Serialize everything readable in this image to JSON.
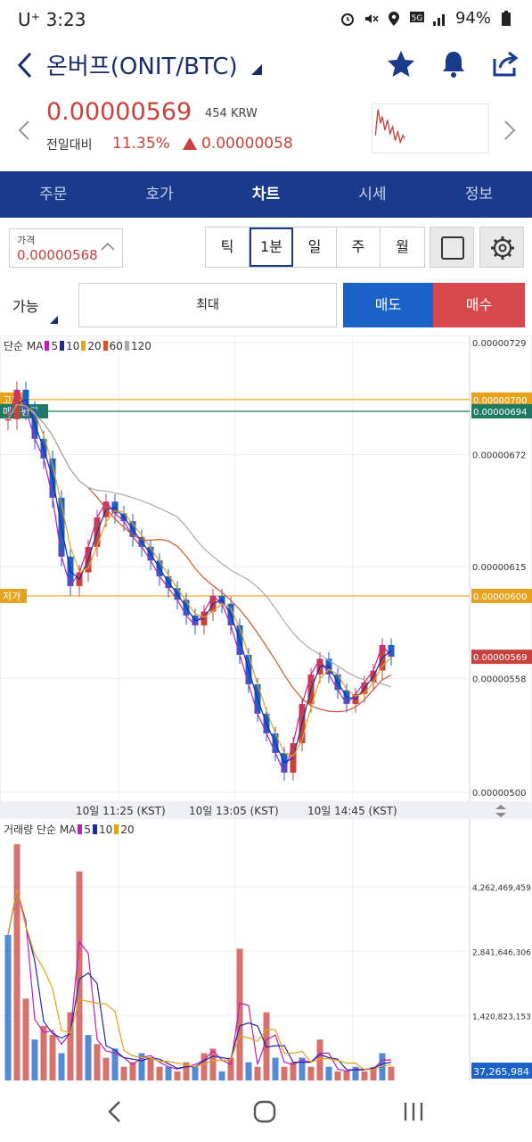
{
  "status_bar": {
    "carrier": "U⁺",
    "time": "3:23",
    "battery": "94%"
  },
  "header": {
    "title": "온버프(ONIT/BTC)"
  },
  "summary": {
    "price": "0.00000569",
    "krw": "454 KRW",
    "change_label": "전일대비",
    "change_pct": "11.35%",
    "change_value": "0.00000058"
  },
  "tabs": [
    {
      "label": "주문"
    },
    {
      "label": "호가"
    },
    {
      "label": "차트",
      "active": true
    },
    {
      "label": "시세"
    },
    {
      "label": "정보"
    }
  ],
  "controls": {
    "price_label": "가격",
    "price_value": "0.00000568",
    "periods": [
      {
        "label": "틱"
      },
      {
        "label": "1분",
        "active": true
      },
      {
        "label": "일"
      },
      {
        "label": "주"
      },
      {
        "label": "월"
      }
    ],
    "available_label": "가능",
    "max_label": "최대",
    "sell_label": "매도",
    "buy_label": "매수"
  },
  "colors": {
    "brand": "#1a3a8c",
    "up": "#c8423d",
    "down": "#1a62c8",
    "ma5": "#c51cb8",
    "ma10": "#1c2aa0",
    "ma20": "#e6a21a",
    "ma60": "#d4542a",
    "ma120": "#aaaaaa"
  },
  "chart_data": [
    {
      "type": "line",
      "legend_title": "단순 MA",
      "series": [
        {
          "name": "5"
        },
        {
          "name": "10"
        },
        {
          "name": "20"
        },
        {
          "name": "60"
        },
        {
          "name": "120"
        }
      ],
      "y_ticks": [
        "0.00000729",
        "0.00000672",
        "0.00000615",
        "0.00000558",
        "0.00000500"
      ],
      "x_ticks": [
        "10일 11:25 (KST)",
        "10일 13:05 (KST)",
        "10일 14:45 (KST)"
      ],
      "price_lines": [
        {
          "label": "고가",
          "value": "0.00000700",
          "color": "#e6a21a"
        },
        {
          "label": "매수평균",
          "value": "0.00000694",
          "color": "#1e7a62"
        },
        {
          "label": "저가",
          "value": "0.00000600",
          "color": "#e6a21a"
        }
      ],
      "current_value": "0.00000569",
      "ylim": [
        5e-06,
        7.29e-06
      ],
      "close": [
        6.9e-06,
        7.05e-06,
        6.95e-06,
        6.8e-06,
        6.7e-06,
        6.5e-06,
        6.2e-06,
        6.05e-06,
        6.12e-06,
        6.25e-06,
        6.4e-06,
        6.48e-06,
        6.42e-06,
        6.38e-06,
        6.3e-06,
        6.25e-06,
        6.18e-06,
        6.1e-06,
        6.04e-06,
        5.98e-06,
        5.9e-06,
        5.85e-06,
        5.92e-06,
        6e-06,
        5.96e-06,
        5.85e-06,
        5.7e-06,
        5.55e-06,
        5.4e-06,
        5.3e-06,
        5.2e-06,
        5.1e-06,
        5.25e-06,
        5.45e-06,
        5.6e-06,
        5.68e-06,
        5.6e-06,
        5.52e-06,
        5.45e-06,
        5.5e-06,
        5.56e-06,
        5.62e-06,
        5.75e-06,
        5.69e-06
      ]
    },
    {
      "type": "bar",
      "legend_title": "거래량 단순 MA",
      "series": [
        {
          "name": "5"
        },
        {
          "name": "10"
        },
        {
          "name": "20"
        }
      ],
      "y_ticks": [
        "4,262,469,459",
        "2,841,646,306",
        "1,420,823,153"
      ],
      "current_value": "37,265,984",
      "ylim": [
        0,
        5400000000
      ],
      "values": [
        3200000000,
        5200000000,
        1800000000,
        900000000,
        1200000000,
        1000000000,
        600000000,
        1500000000,
        4600000000,
        1000000000,
        800000000,
        500000000,
        700000000,
        300000000,
        400000000,
        600000000,
        500000000,
        300000000,
        300000000,
        200000000,
        400000000,
        300000000,
        600000000,
        700000000,
        200000000,
        500000000,
        2900000000,
        400000000,
        300000000,
        1500000000,
        500000000,
        300000000,
        400000000,
        500000000,
        300000000,
        900000000,
        300000000,
        200000000,
        200000000,
        300000000,
        200000000,
        300000000,
        600000000,
        300000000
      ]
    }
  ]
}
